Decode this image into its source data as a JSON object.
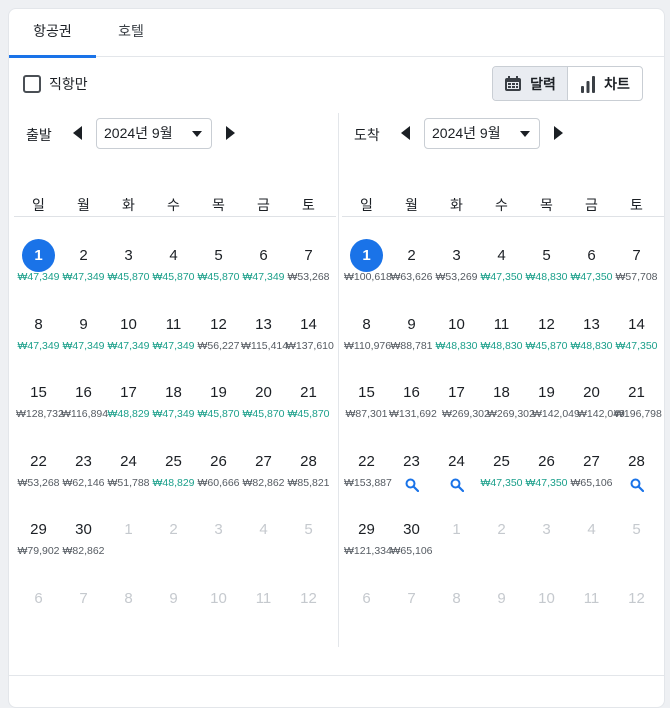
{
  "tabs": [
    {
      "label": "항공권",
      "active": true
    },
    {
      "label": "호텔",
      "active": false
    }
  ],
  "direct_only_label": "직항만",
  "view_toggle": {
    "calendar_label": "달력",
    "chart_label": "차트",
    "selected": "calendar"
  },
  "weekdays": [
    "일",
    "월",
    "화",
    "수",
    "목",
    "금",
    "토"
  ],
  "colors": {
    "accent": "#1a73e8",
    "low_price": "#1a9f8a",
    "price": "#555b62"
  },
  "departure": {
    "label": "출발",
    "month": "2024년 9월",
    "days": [
      {
        "d": "1",
        "p": "₩47,349",
        "low": true,
        "sel": true
      },
      {
        "d": "2",
        "p": "₩47,349",
        "low": true
      },
      {
        "d": "3",
        "p": "₩45,870",
        "low": true
      },
      {
        "d": "4",
        "p": "₩45,870",
        "low": true
      },
      {
        "d": "5",
        "p": "₩45,870",
        "low": true
      },
      {
        "d": "6",
        "p": "₩47,349",
        "low": true
      },
      {
        "d": "7",
        "p": "₩53,268"
      },
      {
        "d": "8",
        "p": "₩47,349",
        "low": true
      },
      {
        "d": "9",
        "p": "₩47,349",
        "low": true
      },
      {
        "d": "10",
        "p": "₩47,349",
        "low": true
      },
      {
        "d": "11",
        "p": "₩47,349",
        "low": true
      },
      {
        "d": "12",
        "p": "₩56,227"
      },
      {
        "d": "13",
        "p": "₩115,414"
      },
      {
        "d": "14",
        "p": "₩137,610"
      },
      {
        "d": "15",
        "p": "₩128,732"
      },
      {
        "d": "16",
        "p": "₩116,894"
      },
      {
        "d": "17",
        "p": "₩48,829",
        "low": true
      },
      {
        "d": "18",
        "p": "₩47,349",
        "low": true
      },
      {
        "d": "19",
        "p": "₩45,870",
        "low": true
      },
      {
        "d": "20",
        "p": "₩45,870",
        "low": true
      },
      {
        "d": "21",
        "p": "₩45,870",
        "low": true
      },
      {
        "d": "22",
        "p": "₩53,268"
      },
      {
        "d": "23",
        "p": "₩62,146"
      },
      {
        "d": "24",
        "p": "₩51,788"
      },
      {
        "d": "25",
        "p": "₩48,829",
        "low": true
      },
      {
        "d": "26",
        "p": "₩60,666"
      },
      {
        "d": "27",
        "p": "₩82,862"
      },
      {
        "d": "28",
        "p": "₩85,821"
      },
      {
        "d": "29",
        "p": "₩79,902"
      },
      {
        "d": "30",
        "p": "₩82,862"
      },
      {
        "d": "1",
        "dim": true
      },
      {
        "d": "2",
        "dim": true
      },
      {
        "d": "3",
        "dim": true
      },
      {
        "d": "4",
        "dim": true
      },
      {
        "d": "5",
        "dim": true
      },
      {
        "d": "6",
        "dim": true
      },
      {
        "d": "7",
        "dim": true
      },
      {
        "d": "8",
        "dim": true
      },
      {
        "d": "9",
        "dim": true
      },
      {
        "d": "10",
        "dim": true
      },
      {
        "d": "11",
        "dim": true
      },
      {
        "d": "12",
        "dim": true
      }
    ]
  },
  "arrival": {
    "label": "도착",
    "month": "2024년 9월",
    "days": [
      {
        "d": "1",
        "p": "₩100,618",
        "sel": true
      },
      {
        "d": "2",
        "p": "₩63,626"
      },
      {
        "d": "3",
        "p": "₩53,269"
      },
      {
        "d": "4",
        "p": "₩47,350",
        "low": true
      },
      {
        "d": "5",
        "p": "₩48,830",
        "low": true
      },
      {
        "d": "6",
        "p": "₩47,350",
        "low": true
      },
      {
        "d": "7",
        "p": "₩57,708"
      },
      {
        "d": "8",
        "p": "₩110,976"
      },
      {
        "d": "9",
        "p": "₩88,781"
      },
      {
        "d": "10",
        "p": "₩48,830",
        "low": true
      },
      {
        "d": "11",
        "p": "₩48,830",
        "low": true
      },
      {
        "d": "12",
        "p": "₩45,870",
        "low": true
      },
      {
        "d": "13",
        "p": "₩48,830",
        "low": true
      },
      {
        "d": "14",
        "p": "₩47,350",
        "low": true
      },
      {
        "d": "15",
        "p": "₩87,301"
      },
      {
        "d": "16",
        "p": "₩131,692"
      },
      {
        "d": "17",
        "p": "₩269,302",
        "wrap": true
      },
      {
        "d": "18",
        "p": "₩269,302",
        "wrap": true
      },
      {
        "d": "19",
        "p": "₩142,049",
        "wrap": true
      },
      {
        "d": "20",
        "p": "₩142,049",
        "wrap": true
      },
      {
        "d": "21",
        "p": "₩196,798"
      },
      {
        "d": "22",
        "p": "₩153,887"
      },
      {
        "d": "23",
        "search": true
      },
      {
        "d": "24",
        "search": true
      },
      {
        "d": "25",
        "p": "₩47,350",
        "low": true
      },
      {
        "d": "26",
        "p": "₩47,350",
        "low": true
      },
      {
        "d": "27",
        "p": "₩65,106"
      },
      {
        "d": "28",
        "search": true
      },
      {
        "d": "29",
        "p": "₩121,334"
      },
      {
        "d": "30",
        "p": "₩65,106"
      },
      {
        "d": "1",
        "dim": true
      },
      {
        "d": "2",
        "dim": true
      },
      {
        "d": "3",
        "dim": true
      },
      {
        "d": "4",
        "dim": true
      },
      {
        "d": "5",
        "dim": true
      },
      {
        "d": "6",
        "dim": true
      },
      {
        "d": "7",
        "dim": true
      },
      {
        "d": "8",
        "dim": true
      },
      {
        "d": "9",
        "dim": true
      },
      {
        "d": "10",
        "dim": true
      },
      {
        "d": "11",
        "dim": true
      },
      {
        "d": "12",
        "dim": true
      }
    ]
  }
}
